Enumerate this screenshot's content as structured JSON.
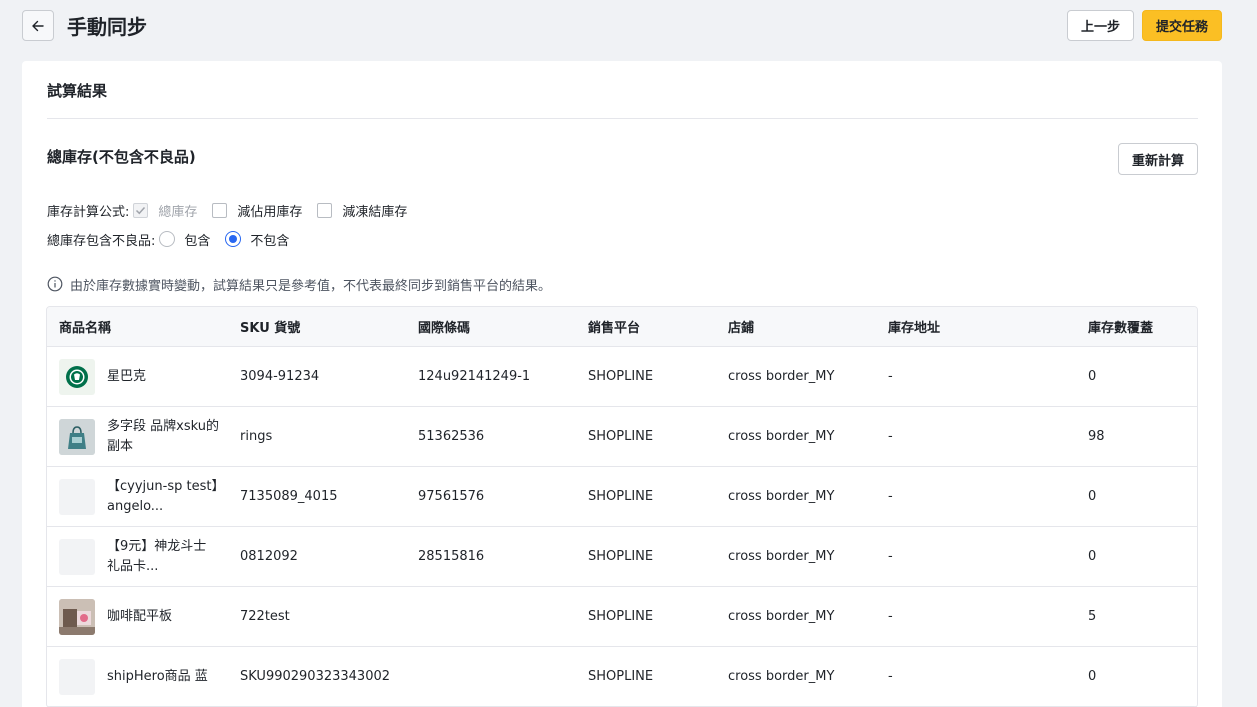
{
  "header": {
    "title": "手動同步",
    "prev_label": "上一步",
    "submit_label": "提交任務"
  },
  "card": {
    "title": "試算結果",
    "section_title": "總庫存(不包含不良品)",
    "recalc_label": "重新計算"
  },
  "formula": {
    "label": "庫存計算公式:",
    "options": [
      {
        "label": "總庫存",
        "checked": true,
        "disabled": true
      },
      {
        "label": "減佔用庫存",
        "checked": false,
        "disabled": false
      },
      {
        "label": "減凍結庫存",
        "checked": false,
        "disabled": false
      }
    ]
  },
  "defect": {
    "label": "總庫存包含不良品:",
    "options": [
      {
        "label": "包含",
        "selected": false
      },
      {
        "label": "不包含",
        "selected": true
      }
    ]
  },
  "notice": "由於庫存數據實時變動，試算結果只是參考值，不代表最終同步到銷售平台的結果。",
  "table": {
    "columns": [
      "商品名稱",
      "SKU 貨號",
      "國際條碼",
      "銷售平台",
      "店鋪",
      "庫存地址",
      "庫存數覆蓋"
    ],
    "rows": [
      {
        "name": "星巴克",
        "sku": "3094-91234",
        "barcode": "124u92141249-1",
        "platform": "SHOPLINE",
        "store": "cross border_MY",
        "address": "-",
        "qty": "0",
        "thumb": "starbucks-logo"
      },
      {
        "name": "多字段 品牌xsku的副本",
        "sku": "rings",
        "barcode": "51362536",
        "platform": "SHOPLINE",
        "store": "cross border_MY",
        "address": "-",
        "qty": "98",
        "thumb": "bag-image"
      },
      {
        "name": "【cyyjun-sp test】angelo...",
        "sku": "7135089_4015",
        "barcode": "97561576",
        "platform": "SHOPLINE",
        "store": "cross border_MY",
        "address": "-",
        "qty": "0",
        "thumb": "placeholder"
      },
      {
        "name": "【9元】神龙斗士 礼品卡...",
        "sku": "0812092",
        "barcode": "28515816",
        "platform": "SHOPLINE",
        "store": "cross border_MY",
        "address": "-",
        "qty": "0",
        "thumb": "placeholder"
      },
      {
        "name": "咖啡配平板",
        "sku": "722test",
        "barcode": "",
        "platform": "SHOPLINE",
        "store": "cross border_MY",
        "address": "-",
        "qty": "5",
        "thumb": "photo-image"
      },
      {
        "name": "shipHero商品 蓝",
        "sku": "SKU990290323343002",
        "barcode": "",
        "platform": "SHOPLINE",
        "store": "cross border_MY",
        "address": "-",
        "qty": "0",
        "thumb": "placeholder"
      }
    ]
  },
  "colors": {
    "primary": "#fbbf24",
    "radio_selected": "#2867f1",
    "background": "#f0f2f5"
  }
}
